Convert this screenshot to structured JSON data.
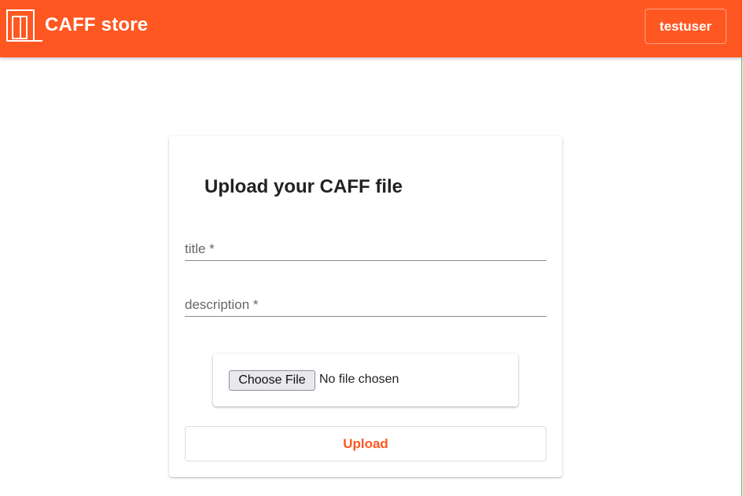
{
  "appbar": {
    "brand_title": "CAFF store",
    "user_label": "testuser",
    "logo_icon": "door-icon",
    "background_color": "#ff5722"
  },
  "upload_card": {
    "title": "Upload your CAFF file",
    "title_field": {
      "placeholder": "title *",
      "value": ""
    },
    "description_field": {
      "placeholder": "description *",
      "value": ""
    },
    "file_picker": {
      "button_label": "Choose File",
      "status_text": "No file chosen"
    },
    "upload_label": "Upload",
    "accent_color": "#ff5722"
  }
}
